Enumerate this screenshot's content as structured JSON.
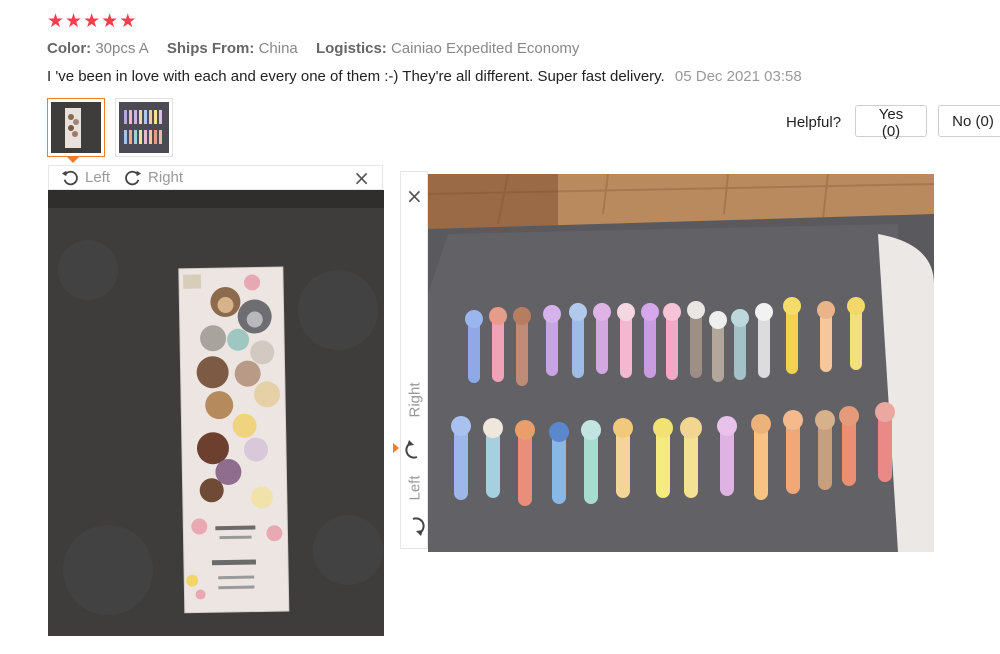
{
  "rating": {
    "stars": 5,
    "star_glyph": "★",
    "color": "#f0404b"
  },
  "attributes": {
    "color_label": "Color:",
    "color_value": "30pcs A",
    "ships_label": "Ships From:",
    "ships_value": "China",
    "logistics_label": "Logistics:",
    "logistics_value": "Cainiao Expedited Economy"
  },
  "review": {
    "text": "I 've been in love with each and every one of them :-) They're all different. Super fast delivery.",
    "date": "05 Dec 2021 03:58"
  },
  "thumbnails": [
    {
      "name": "thumbnail-1",
      "active": true
    },
    {
      "name": "thumbnail-2",
      "active": false
    }
  ],
  "helpful": {
    "label": "Helpful?",
    "yes_label": "Yes (0)",
    "no_label": "No (0)"
  },
  "viewer_left": {
    "rotate_left_label": "Left",
    "rotate_right_label": "Right",
    "close_glyph": "×"
  },
  "viewer_right": {
    "rotate_left_label": "Left",
    "rotate_right_label": "Right",
    "close_glyph": "×"
  },
  "colors": {
    "accent": "#f07c2a",
    "muted": "#999999"
  }
}
